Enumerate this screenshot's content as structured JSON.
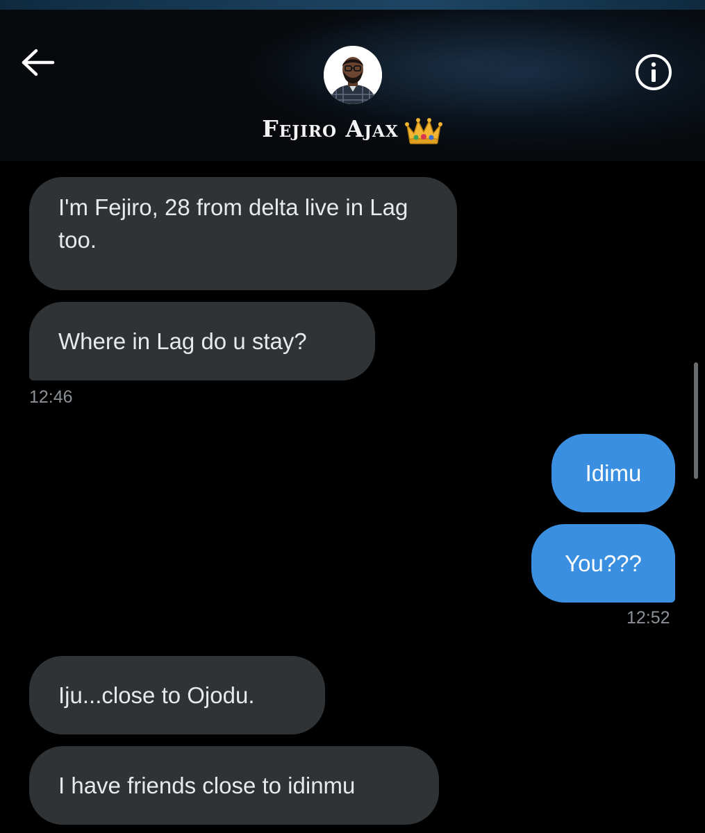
{
  "header": {
    "contact_name": "Fejiro Ajax",
    "back_icon": "arrow-left-icon",
    "info_icon": "info-circle-icon",
    "crown_icon": "crown-emoji-icon"
  },
  "messages": [
    {
      "direction": "received",
      "text": "I'm Fejiro, 28 from delta live in Lag too."
    },
    {
      "direction": "received",
      "text": "Where in Lag do u stay?"
    },
    {
      "direction": "sent",
      "text": "Idimu"
    },
    {
      "direction": "sent",
      "text": "You???"
    },
    {
      "direction": "received",
      "text": "Iju...close to Ojodu."
    },
    {
      "direction": "received",
      "text": "I have friends close to idinmu"
    }
  ],
  "timestamps": [
    "12:46",
    "12:52"
  ],
  "colors": {
    "sent_bubble": "#3b8fe0",
    "received_bubble": "#2f3336",
    "background": "#000000",
    "timestamp_text": "#8b9197"
  }
}
